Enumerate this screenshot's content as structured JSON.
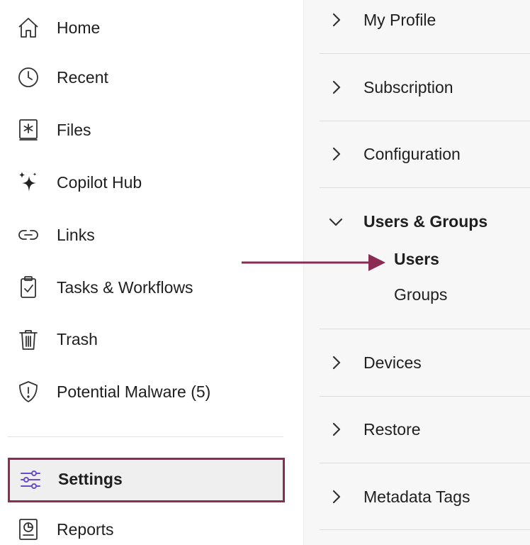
{
  "sidebar": {
    "items": [
      {
        "label": "Home",
        "icon": "home-icon"
      },
      {
        "label": "Recent",
        "icon": "clock-icon"
      },
      {
        "label": "Files",
        "icon": "files-icon"
      },
      {
        "label": "Copilot Hub",
        "icon": "sparkle-icon"
      },
      {
        "label": "Links",
        "icon": "link-icon"
      },
      {
        "label": "Tasks & Workflows",
        "icon": "clipboard-check-icon"
      },
      {
        "label": "Trash",
        "icon": "trash-icon"
      },
      {
        "label": "Potential Malware (5)",
        "icon": "shield-alert-icon"
      }
    ],
    "settings": {
      "label": "Settings",
      "icon": "sliders-icon",
      "selected": true
    },
    "reports": {
      "label": "Reports",
      "icon": "report-icon"
    }
  },
  "settings_panel": {
    "sections": [
      {
        "label": "My Profile",
        "expanded": false
      },
      {
        "label": "Subscription",
        "expanded": false
      },
      {
        "label": "Configuration",
        "expanded": false
      },
      {
        "label": "Users & Groups",
        "expanded": true,
        "children": [
          "Users",
          "Groups"
        ],
        "active_child": "Users"
      },
      {
        "label": "Devices",
        "expanded": false
      },
      {
        "label": "Restore",
        "expanded": false
      },
      {
        "label": "Metadata Tags",
        "expanded": false
      }
    ]
  },
  "colors": {
    "highlight_border": "#8b2c55",
    "arrow": "#8b2c55",
    "settings_icon": "#6b4fc8",
    "selected_bg": "#efefef",
    "panel_bg": "#f7f7f7"
  }
}
